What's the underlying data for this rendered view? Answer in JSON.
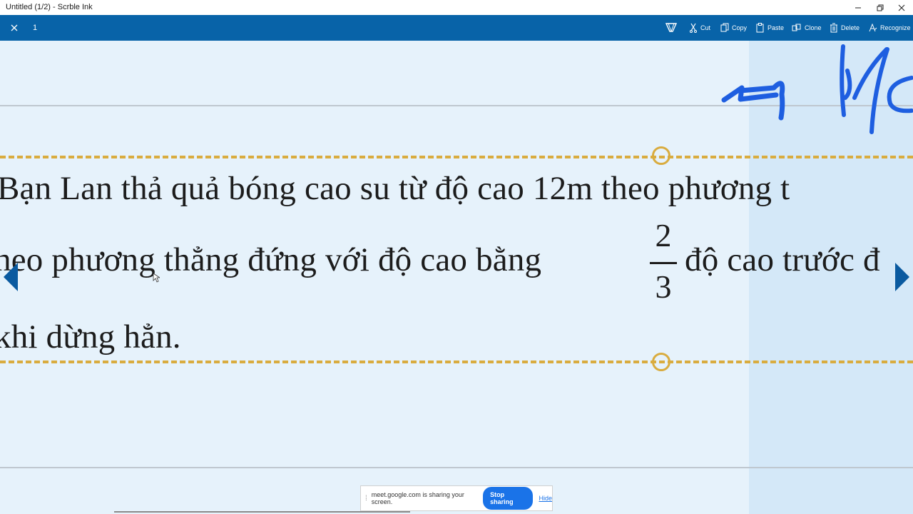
{
  "window": {
    "title": "Untitled (1/2) - Scrble Ink"
  },
  "toolbar": {
    "page_number": "1",
    "items": [
      {
        "icon": "lasso-icon",
        "label": ""
      },
      {
        "icon": "scissors-icon",
        "label": "Cut"
      },
      {
        "icon": "copy-icon",
        "label": "Copy"
      },
      {
        "icon": "paste-icon",
        "label": "Paste"
      },
      {
        "icon": "clone-icon",
        "label": "Clone"
      },
      {
        "icon": "trash-icon",
        "label": "Delete"
      },
      {
        "icon": "recognize-icon",
        "label": "Recognize"
      }
    ]
  },
  "document": {
    "line1": "Bạn Lan thả quả bóng cao su từ độ cao 12m theo phương t",
    "line2_before": "heo phương thẳng đứng với  độ cao bằng",
    "fraction_numerator": "2",
    "fraction_denominator": "3",
    "line2_after": "độ cao trước đ",
    "line3": "khi dừng hẳn."
  },
  "share_bar": {
    "message": "meet.google.com is sharing your screen.",
    "stop_label": "Stop sharing",
    "hide_label": "Hide"
  },
  "colors": {
    "toolbar": "#0863a8",
    "canvas": "#e6f2fb",
    "selection_band": "#d4e8f8",
    "dashed_guide": "#d9ac3f",
    "ink": "#1e5ee0",
    "nav_arrow": "#0a5aa0"
  }
}
